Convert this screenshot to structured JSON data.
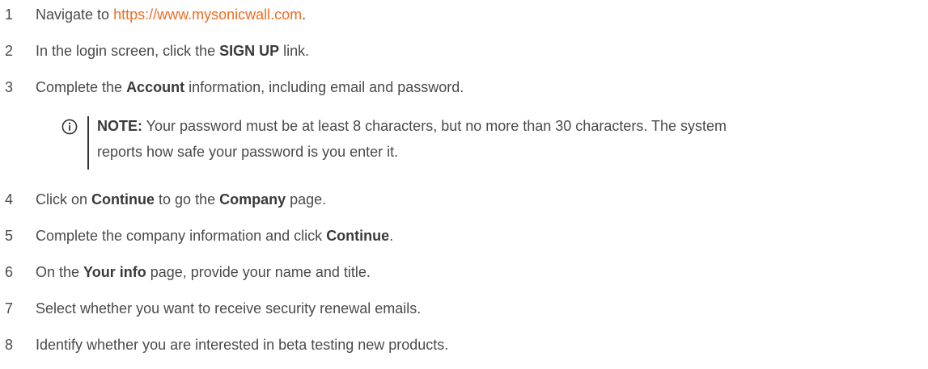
{
  "steps": [
    {
      "number": "1",
      "prefix": "Navigate to ",
      "link": "https://www.mysonicwall.com",
      "suffix": "."
    },
    {
      "number": "2",
      "prefix": "In the login screen, click the ",
      "bold": "SIGN UP",
      "suffix": " link."
    },
    {
      "number": "3",
      "prefix": "Complete the ",
      "bold": "Account",
      "suffix": " information, including email and password."
    },
    {
      "number": "4",
      "prefix": "Click on ",
      "bold": "Continue",
      "middle": " to go the ",
      "bold2": "Company",
      "suffix": " page."
    },
    {
      "number": "5",
      "prefix": "Complete the company information and click ",
      "bold": "Continue",
      "suffix": "."
    },
    {
      "number": "6",
      "prefix": "On the ",
      "bold": "Your info",
      "suffix": " page, provide your name and title."
    },
    {
      "number": "7",
      "text": "Select whether you want to receive security renewal emails."
    },
    {
      "number": "8",
      "text": "Identify whether you are interested in beta testing new products."
    }
  ],
  "note": {
    "label": "NOTE:",
    "line1": " Your password must be at least 8 characters, but no more than 30 characters. The system",
    "line2": "reports how safe your password is you enter it.",
    "icon": "info-icon"
  },
  "colors": {
    "link": "#f26b21",
    "text": "#4a4a4a"
  }
}
